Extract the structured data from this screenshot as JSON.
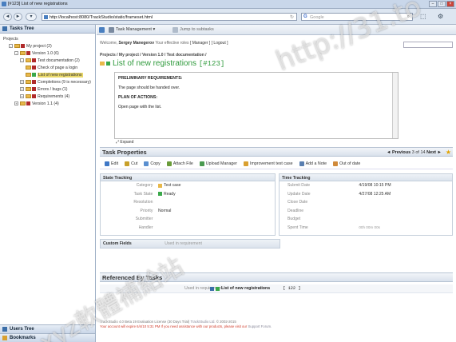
{
  "browser": {
    "window_title": "[#123] List of new registrations",
    "address": "http://localhost:8080/TrackStudio/static/frameset.html",
    "search_placeholder": "Google",
    "search_logo": "G"
  },
  "left": {
    "tasks_tree_label": "Tasks Tree",
    "users_tree_label": "Users Tree",
    "bookmarks_label": "Bookmarks",
    "tree": [
      {
        "label": "Projects",
        "indent": 0,
        "pm": "",
        "color": "",
        "selected": false
      },
      {
        "label": "My project (2)",
        "indent": 1,
        "pm": "-",
        "color": "#b02a2a",
        "selected": false
      },
      {
        "label": "Version 1.0 (6)",
        "indent": 2,
        "pm": "-",
        "color": "#b02a2a",
        "selected": false
      },
      {
        "label": "Test documentation (2)",
        "indent": 3,
        "pm": "-",
        "color": "#b02a2a",
        "selected": false
      },
      {
        "label": "Check of page a login",
        "indent": 4,
        "pm": "",
        "color": "#b02a2a",
        "selected": false
      },
      {
        "label": "List of new registrations",
        "indent": 4,
        "pm": "",
        "color": "#3aa84a",
        "selected": true
      },
      {
        "label": "Completions (9 is necessary)",
        "indent": 3,
        "pm": "+",
        "color": "#b02a2a",
        "selected": false
      },
      {
        "label": "Errors / bugs (1)",
        "indent": 3,
        "pm": "+",
        "color": "#b02a2a",
        "selected": false
      },
      {
        "label": "Requirements (4)",
        "indent": 3,
        "pm": "+",
        "color": "#b02a2a",
        "selected": false
      },
      {
        "label": "Version 1.1 (4)",
        "indent": 2,
        "pm": "+",
        "color": "#b02a2a",
        "selected": false
      }
    ]
  },
  "main": {
    "toolbar": {
      "task_management": "Task Management ▾",
      "jump": "Jump to subtasks"
    },
    "welcome": {
      "prefix": "Welcome,",
      "user": "Sergey Manegerov",
      "roles": "Your effective roles",
      "manager": "[ Manager ]",
      "logout": "[ Logout ]"
    },
    "breadcrumbs": "Projects  /  My project  /  Version 1.0  /  Test documentation  /",
    "title": "List of new registrations",
    "title_num": "[#123]",
    "description": {
      "h1": "PRELIMINARY REQUIREMENTS:",
      "p1": "The page should be handed over.",
      "h2": "PLAN OF ACTIONS:",
      "p2": "Open page with the list."
    },
    "expand_label": "Expand",
    "task_properties_title": "Task Properties",
    "pager": {
      "prev": "◄ Previous",
      "pos": "3",
      "of": "of",
      "total": "14",
      "next": "Next ►"
    },
    "actions": [
      {
        "label": "Edit",
        "color": "#3f78c6"
      },
      {
        "label": "Cut",
        "color": "#c8a02a"
      },
      {
        "label": "Copy",
        "color": "#5a8fd0"
      },
      {
        "label": "Attach File",
        "color": "#6a9c3a"
      },
      {
        "label": "Upload Manager",
        "color": "#4a9a50"
      },
      {
        "label": "Improvement test case",
        "color": "#d9a030"
      },
      {
        "label": "Add a Note",
        "color": "#5a7fb0"
      },
      {
        "label": "Out of date",
        "color": "#d08a3a"
      }
    ],
    "state_tracking": {
      "title": "State Tracking",
      "rows": [
        {
          "k": "Category",
          "v": "Test case",
          "color": "#e8b84a"
        },
        {
          "k": "Task State",
          "v": "Ready",
          "color": "#3aa84a"
        },
        {
          "k": "Resolution",
          "v": "",
          "color": ""
        },
        {
          "k": "Priority",
          "v": "Normal",
          "color": ""
        },
        {
          "k": "Submitter",
          "v": "",
          "color": ""
        },
        {
          "k": "Handler",
          "v": "",
          "color": ""
        }
      ]
    },
    "time_tracking": {
      "title": "Time Tracking",
      "rows": [
        {
          "k": "Submit Date",
          "v": "4/19/08 10:15 PM"
        },
        {
          "k": "Update Date",
          "v": "4/27/08 12:25 AM"
        },
        {
          "k": "Close Date",
          "v": ""
        },
        {
          "k": "Deadline",
          "v": ""
        },
        {
          "k": "Budget",
          "v": ""
        },
        {
          "k": "Spent Time",
          "v": "00h 00m 00s"
        }
      ]
    },
    "custom_fields": {
      "title": "Custom Fields",
      "related": "Used in requirement"
    },
    "referenced_title": "Referenced By Tasks",
    "referenced_row": {
      "k": "Used in requirement",
      "v": "List of new registrations",
      "num": "[ 122 ]"
    },
    "footer": {
      "line1": "TrackStudio 4.0 Beta 19 Evaluation License (30 Days Trial)",
      "line1b": "TrackStudio Ltd.",
      "line1c": "© 2002-2015",
      "line2": "Your account will expire 6/4/10 5:31 PM If you need assistance with our products, please visit our",
      "line2b": "Support Forum."
    }
  },
  "watermark": {
    "url": "http://31.to",
    "chars": "xyz軟體補給站"
  }
}
